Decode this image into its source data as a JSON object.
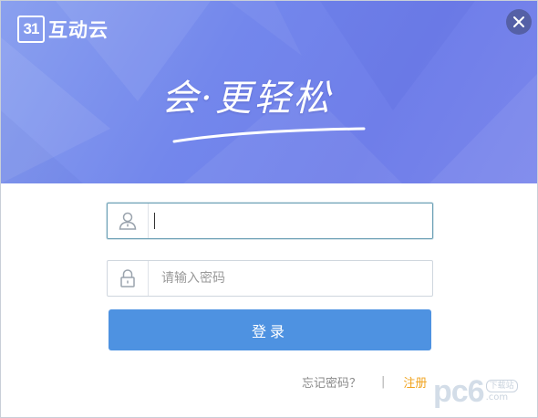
{
  "app": {
    "logo_badge": "31",
    "logo_text": "互动云",
    "slogan": "会·更轻松"
  },
  "form": {
    "username": {
      "value": "",
      "placeholder": ""
    },
    "password": {
      "value": "",
      "placeholder": "请输入密码"
    },
    "login_label": "登录"
  },
  "links": {
    "forgot_password": "忘记密码？",
    "separator": "|",
    "register": "注册"
  },
  "watermark": {
    "main": "pc6",
    "side_top": "下载站",
    "side_bottom": ".com"
  },
  "colors": {
    "banner_primary": "#7387ec",
    "login_button": "#4e92e1",
    "register_link": "#f0a21c"
  },
  "icons": {
    "close": "close-icon",
    "user": "user-icon",
    "lock": "lock-icon"
  }
}
